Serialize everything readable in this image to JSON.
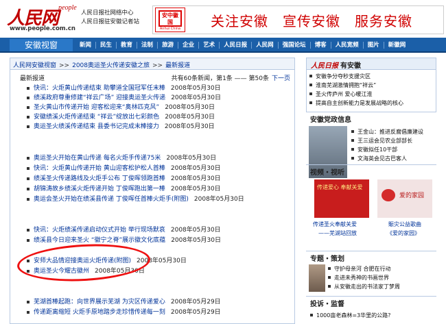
{
  "header": {
    "logo_text": "人民网",
    "logo_people": "people",
    "url": "www.people.com.cn",
    "sub_lines": [
      "人民日报社网络中心",
      "人民日报驻安徽记者站"
    ],
    "seal_text": "安中徽国",
    "seal_sub": "Anhui China",
    "slogan": "关注安徽　宣传安徽　服务安徽"
  },
  "nav": {
    "site_tab": "安徽视窗",
    "links": [
      "新闻",
      "民生",
      "教育",
      "法制",
      "旅游",
      "企业",
      "艺术",
      "人民日报",
      "人民网",
      "强国论坛",
      "博客",
      "人民宽频",
      "图片",
      "新徽网"
    ]
  },
  "breadcrumb": [
    "人民网安徽视窗",
    "2008奥运圣火传递安徽之旅",
    "最新报道"
  ],
  "list": {
    "heading": "最新报道",
    "pager": "共有60条新闻，第1条 —— 第50条",
    "next": "下一页",
    "items": [
      {
        "title": "快讯：火炬黄山传递结束 助攀道全国冠军任末棒",
        "date": "2008年05月30日"
      },
      {
        "title": "绩溪政府尊重修建“祥云广场” 迎接奥运圣火传递",
        "date": "2008年05月30日"
      },
      {
        "title": "圣火黄山市传递开始 迎客松迎来“奥林匹克风”",
        "date": "2008年05月30日"
      },
      {
        "title": "安徽绩溪火炬传递结束 “祥云”绽放出七彩颜色",
        "date": "2008年05月30日"
      },
      {
        "title": "奥运圣火绩溪传递结束 县委书记完成末棒接力",
        "date": "2008年05月30日"
      },
      {
        "title": "奥运圣火开始在黄山传递 每名火炬手传递75米",
        "date": "2008年05月30日"
      },
      {
        "title": "快讯：火炬黄山传递开始 黄山迎客松护松人首棒",
        "date": "2008年05月30日"
      },
      {
        "title": "绩溪圣火传递路线及火炬手公布 丁俊晖领跑首棒",
        "date": "2008年05月30日"
      },
      {
        "title": "胡锦涛故乡绩溪火炬传递开始 丁俊晖跑出第一棒",
        "date": "2008年05月30日"
      },
      {
        "title": "奥运会圣火开始在绩溪县传递 丁俊晖任首棒火炬手(附图)",
        "date": "2008年05月30日"
      },
      {
        "title": "快讯：火炬绩溪传递启动仪式开始 举行现场默哀",
        "date": "2008年05月30日"
      },
      {
        "title": "绩溪县今日迎来圣火 “徽宁之脊”展示徽文化底蕴",
        "date": "2008年05月30日"
      },
      {
        "title": "安师大品情迎接奥运火炬传递(附图)",
        "date": "2008年05月30日"
      },
      {
        "title": "奥运圣火今耀古徽州",
        "date": "2008年05月30日"
      },
      {
        "title": "芜湖首棒起跑：向世界展示芜湖 为灾区传递爱心",
        "date": "2008年05月29日"
      },
      {
        "title": "传递距离缩短 火炬手原地踏步走珍惜传递每一刻",
        "date": "2008年05月29日"
      }
    ]
  },
  "sidebar": {
    "rmrb": {
      "logo": "人民日报",
      "title": "有安徽",
      "items": [
        "安徽争分夺秒支援灾区",
        "淮南芜湖激情拥抱“祥云”",
        "圣火传庐州 爱心暖江淮",
        "提高自主创新能力是发展战略的核心"
      ]
    },
    "gov": {
      "title": "安徽党政信息",
      "items": [
        "王金山：推进反腐倡廉建设",
        "王三运会见农业部部长",
        "安徽拟任10干部",
        "文海英会见古巴客人"
      ]
    },
    "video": {
      "title": "视频・视听",
      "poster1": "传递爱心 奉献关爱",
      "poster2": "爱的家园",
      "caps": [
        "传递圣火奉献关爱",
        "——芜湖站回放",
        "賑灾公益歌曲",
        "《爱的家园》"
      ]
    },
    "topic": {
      "title": "专题・策划",
      "items": [
        "守护母亲河 合肥在行动",
        "走进未秀神的书画世界",
        "从安徽走出的书法家丁梦周"
      ]
    },
    "complaint": {
      "title": "投诉・监督",
      "items": [
        "1000亩老森林=3华里的公路?"
      ]
    }
  }
}
